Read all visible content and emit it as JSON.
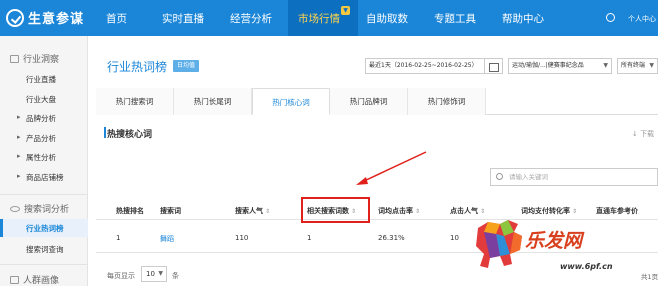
{
  "app": {
    "name": "生意参谋",
    "brand_color": "#1b86d8"
  },
  "nav": {
    "items": [
      "首页",
      "实时直播",
      "经营分析"
    ],
    "active": "市场行情",
    "rest": [
      "自助取数",
      "专题工具",
      "帮助中心"
    ],
    "user_center": "个人中心"
  },
  "sidebar": {
    "group1": "行业洞察",
    "group1_items": [
      "行业直播",
      "行业大盘"
    ],
    "group1_expand": [
      "品牌分析",
      "产品分析",
      "属性分析",
      "商品店铺榜"
    ],
    "group2": "搜索词分析",
    "group2_active": "行业热词榜",
    "group2_items": [
      "搜索词查询"
    ],
    "group3": "人群画像"
  },
  "header": {
    "title": "行业热词榜",
    "period_badge": "日均值",
    "date_range": "最近1天（2016-02-25~2016-02-25）",
    "category": "运动/瑜伽/...|健赛事纪念品",
    "terminal": "所有终端"
  },
  "tabs": [
    "热门搜索词",
    "热门长尾词",
    "热门核心词",
    "热门品牌词",
    "热门修饰词"
  ],
  "active_tab_index": 2,
  "section": {
    "title": "热搜核心词",
    "download": "下载"
  },
  "search": {
    "placeholder": "请输入关键词"
  },
  "table": {
    "headers": [
      "热搜排名",
      "搜索词",
      "搜索人气",
      "相关搜索词数",
      "词均点击率",
      "点击人气",
      "词均支付转化率",
      "直通车参考价"
    ],
    "rows": [
      [
        "1",
        "舞蹈",
        "110",
        "1",
        "26.31%",
        "10",
        "",
        ""
      ]
    ]
  },
  "pager": {
    "label": "每页显示",
    "size": "10",
    "unit": "条",
    "total": "共1页"
  },
  "watermark": {
    "title": "乐发网",
    "url": "www.6pf.cn"
  },
  "annotation_color": "#e0201b"
}
